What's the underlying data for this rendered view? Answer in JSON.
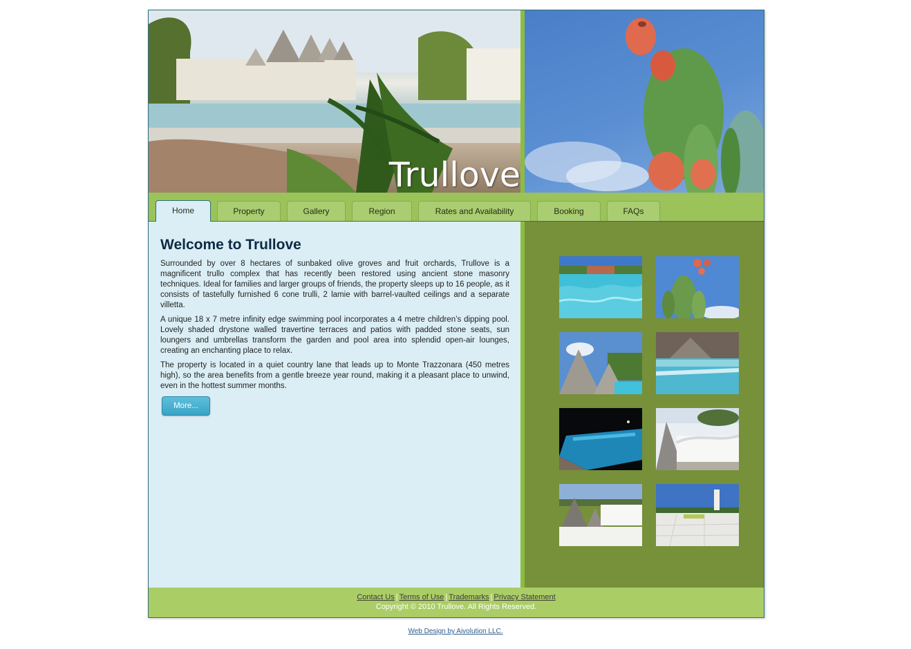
{
  "header": {
    "brand": "Trullove",
    "photo_icon": "trulli-pool-photo",
    "cactus_icon": "prickly-pear-cactus-photo"
  },
  "nav": {
    "tabs": [
      {
        "label": "Home",
        "active": true
      },
      {
        "label": "Property",
        "active": false
      },
      {
        "label": "Gallery",
        "active": false
      },
      {
        "label": "Region",
        "active": false
      },
      {
        "label": "Rates and Availability",
        "active": false
      },
      {
        "label": "Booking",
        "active": false
      },
      {
        "label": "FAQs",
        "active": false
      }
    ]
  },
  "main": {
    "title": "Welcome to Trullove",
    "paragraphs": [
      "Surrounded by over 8 hectares of sunbaked olive groves and fruit orchards, Trullove is a magnificent trullo complex that has recently been restored using ancient stone masonry techniques. Ideal for families and larger groups of friends, the property sleeps up to 16 people, as it consists of tastefully furnished 6 cone trulli, 2 lamie with barrel-vaulted ceilings and a separate villetta.",
      "A unique 18 x 7 metre infinity edge swimming pool incorporates a 4 metre children’s dipping pool. Lovely shaded drystone walled travertine terraces and patios with padded stone seats, sun loungers and umbrellas transform the garden and pool area into splendid open-air lounges, creating an enchanting place to relax.",
      "The property is located in a quiet country lane that leads up to Monte Trazzonara (450 metres high), so the area benefits from a gentle breeze year round, making it a pleasant place to unwind, even in the hottest summer months."
    ],
    "more_label": "More..."
  },
  "gallery": {
    "thumbnails": [
      "pool-water-photo",
      "cactus-fruit-photo",
      "trulli-cones-photo",
      "pool-reflection-photo",
      "pool-night-photo",
      "trullo-roof-photo",
      "roof-terrace-photo",
      "terrace-chimney-photo"
    ]
  },
  "footer": {
    "links": [
      "Contact Us",
      "Terms of Use",
      "Trademarks",
      "Privacy Statement"
    ],
    "separator": "|",
    "copyright": "Copyright © 2010 Trullove. All Rights Reserved.",
    "credit": "Web Design by Aivolution LLC."
  },
  "colors": {
    "nav_green": "#9cc25a",
    "accent_green": "#8cbd3f",
    "gallery_bg": "#77903a",
    "content_bg": "#dbeef5",
    "button_blue": "#3aa3c6",
    "title_navy": "#0d2a44"
  }
}
